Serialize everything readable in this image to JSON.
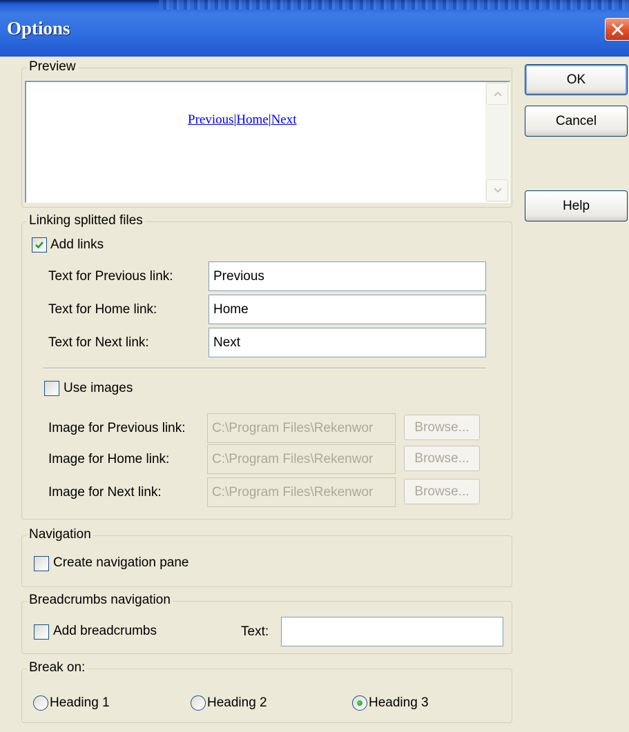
{
  "window": {
    "title": "Options"
  },
  "buttons": {
    "ok": "OK",
    "cancel": "Cancel",
    "help": "Help"
  },
  "preview": {
    "legend": "Preview",
    "links": {
      "previous": "Previous",
      "home": "Home",
      "next": "Next",
      "separator": "|"
    }
  },
  "linking": {
    "legend": "Linking splitted files",
    "add_links": {
      "label": "Add links",
      "checked": true
    },
    "prev_label": "Text for Previous link:",
    "prev_value": "Previous",
    "home_label": "Text for Home link:",
    "home_value": "Home",
    "next_label": "Text for Next link:",
    "next_value": "Next",
    "use_images": {
      "label": "Use images",
      "checked": false
    },
    "img_prev_label": "Image for Previous link:",
    "img_home_label": "Image for Home link:",
    "img_next_label": "Image for Next link:",
    "img_path": "C:\\Program Files\\Rekenwor",
    "browse": "Browse..."
  },
  "navigation": {
    "legend": "Navigation",
    "create_pane": {
      "label": "Create navigation pane",
      "checked": false
    }
  },
  "breadcrumbs": {
    "legend": "Breadcrumbs navigation",
    "add": {
      "label": "Add breadcrumbs",
      "checked": false
    },
    "text_label": "Text:",
    "text_value": ""
  },
  "break_on": {
    "legend": "Break on:",
    "options": [
      "Heading 1",
      "Heading 2",
      "Heading 3"
    ],
    "selected": "Heading 3"
  },
  "colors": {
    "titlebar": "#2f6ee0",
    "dialog_bg": "#ece9d8",
    "link": "#0000ee",
    "close": "#e0502a"
  }
}
